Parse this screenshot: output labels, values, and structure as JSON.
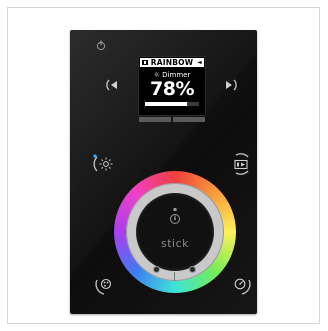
{
  "screen": {
    "mode_label": "RAINBOW",
    "dimmer_label": "Dimmer",
    "value_text": "78%",
    "progress": 0.78
  },
  "wheel": {
    "logo_text": "stick"
  },
  "icons": {
    "power": "power-icon",
    "left": "chevron-left-icon",
    "right": "chevron-right-icon",
    "brightness": "brightness-icon",
    "scene": "scene-icon",
    "color": "color-palette-icon",
    "speed": "speed-icon"
  }
}
